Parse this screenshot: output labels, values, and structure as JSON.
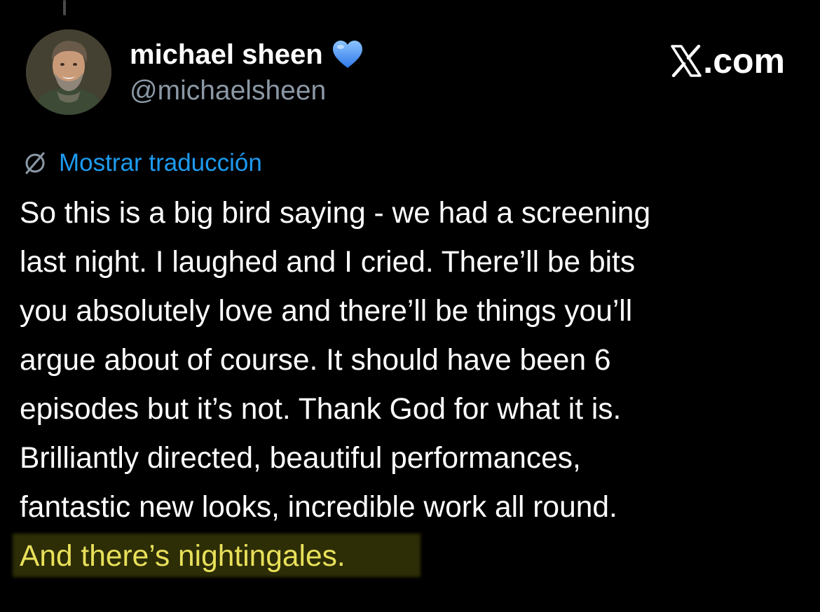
{
  "author": {
    "display_name": "michael sheen",
    "handle": "@michaelsheen",
    "badge_icon": "blue-heart-icon",
    "badge_color": "#5b9ff5"
  },
  "brand": {
    "text": ".com",
    "logo_icon": "x-logo-icon"
  },
  "translation": {
    "label": "Mostrar traducción",
    "icon": "globe-slash-icon",
    "link_color": "#1d9bf0"
  },
  "tweet": {
    "lines": [
      "So this is a big bird saying - we had a screening",
      "last night. I laughed and I cried. There’ll be bits",
      "you absolutely love and there’ll be things you’ll",
      "argue about of course. It should have been 6",
      "episodes but it’s not. Thank God for what it is.",
      "Brilliantly directed, beautiful performances,",
      "fantastic new looks, incredible work all round."
    ],
    "highlighted_line": "And there’s nightingales.",
    "highlight_color": "#e8e05a"
  },
  "colors": {
    "background": "#000000",
    "text": "#ffffff",
    "secondary_text": "#8b98a5"
  }
}
